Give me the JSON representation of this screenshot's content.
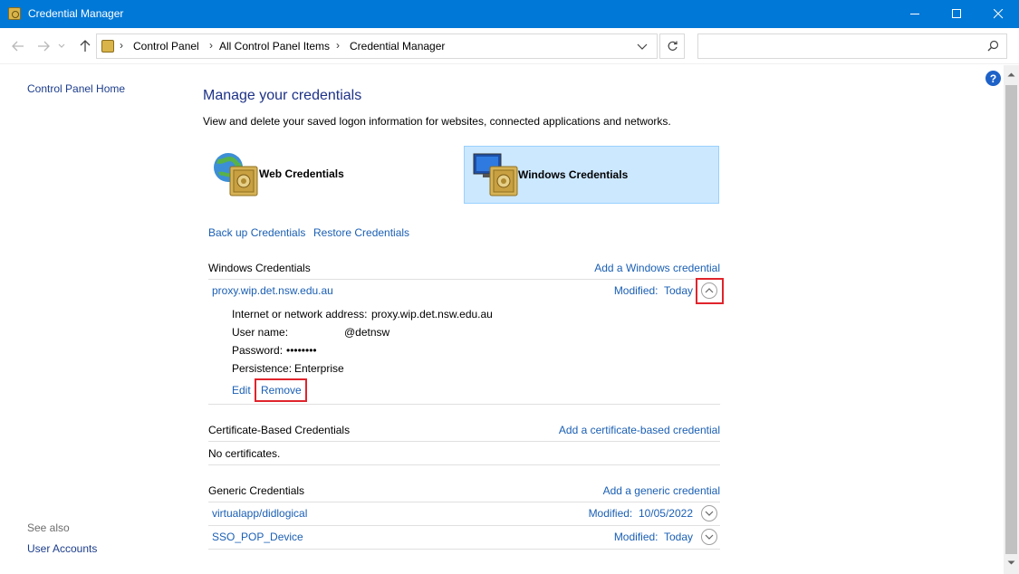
{
  "window": {
    "title": "Credential Manager"
  },
  "address_bar": {
    "crumbs": [
      "Control Panel",
      "All Control Panel Items",
      "Credential Manager"
    ],
    "search_placeholder": ""
  },
  "left_pane": {
    "home_link": "Control Panel Home",
    "see_also_label": "See also",
    "user_accounts_link": "User Accounts"
  },
  "main": {
    "heading": "Manage your credentials",
    "subtext": "View and delete your saved logon information for websites, connected applications and networks.",
    "tabs": {
      "web": "Web Credentials",
      "windows": "Windows Credentials"
    },
    "backup_link": "Back up Credentials",
    "restore_link": "Restore Credentials"
  },
  "windows_section": {
    "title": "Windows Credentials",
    "add_link": "Add a Windows credential",
    "entry": {
      "name": "proxy.wip.det.nsw.edu.au",
      "modified_label": "Modified:",
      "modified_value": "Today",
      "address_label": "Internet or network address:",
      "address_value": "proxy.wip.det.nsw.edu.au",
      "username_label": "User name:",
      "username_value": "@detnsw",
      "password_label": "Password:",
      "password_value": "••••••••",
      "persistence_label": "Persistence:",
      "persistence_value": "Enterprise",
      "edit_link": "Edit",
      "remove_link": "Remove"
    }
  },
  "certificate_section": {
    "title": "Certificate-Based Credentials",
    "add_link": "Add a certificate-based credential",
    "empty_text": "No certificates."
  },
  "generic_section": {
    "title": "Generic Credentials",
    "add_link": "Add a generic credential",
    "entries": [
      {
        "name": "virtualapp/didlogical",
        "modified_label": "Modified:",
        "modified_value": "10/05/2022"
      },
      {
        "name": "SSO_POP_Device",
        "modified_label": "Modified:",
        "modified_value": "Today"
      }
    ]
  },
  "help_glyph": "?",
  "colors": {
    "titlebar": "#0078d7",
    "link": "#1a5fb4",
    "selected_tile": "#cce8ff",
    "highlight_box": "#e0242c"
  }
}
